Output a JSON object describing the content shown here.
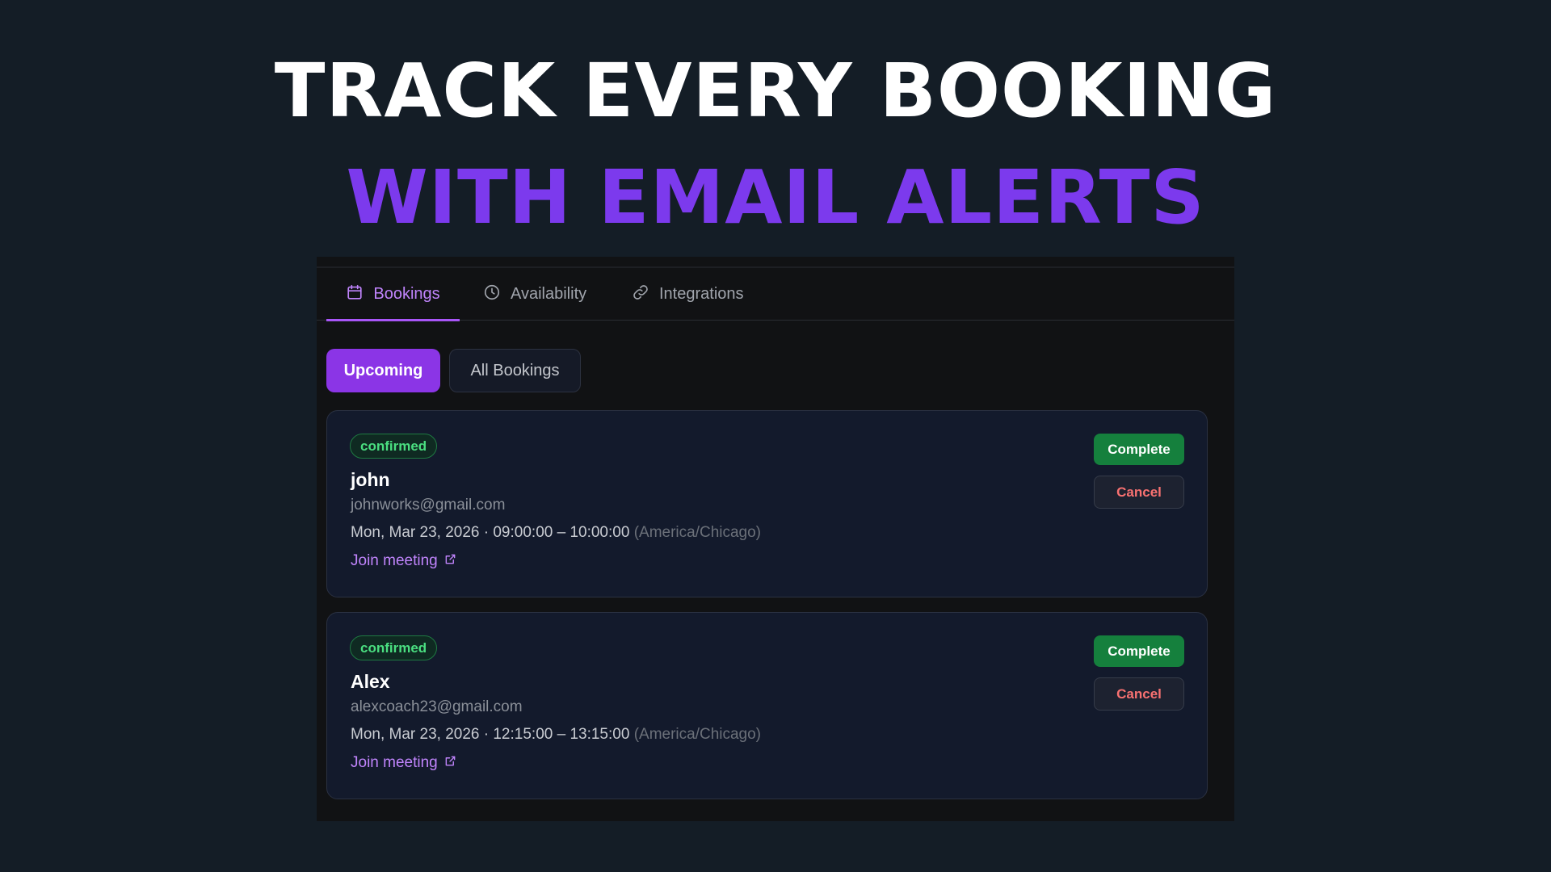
{
  "headline": {
    "line1": "TRACK EVERY BOOKING",
    "line2": "WITH EMAIL ALERTS"
  },
  "colors": {
    "background": "#141d26",
    "headline_accent": "#7c3aed",
    "active_tab": "#c084fc",
    "primary_button": "#8b35e6",
    "complete_button": "#15803d",
    "cancel_text": "#f87171",
    "badge_text": "#4ade80"
  },
  "tabs": [
    {
      "label": "Bookings",
      "icon": "calendar-icon",
      "active": true
    },
    {
      "label": "Availability",
      "icon": "clock-icon",
      "active": false
    },
    {
      "label": "Integrations",
      "icon": "link-icon",
      "active": false
    }
  ],
  "filters": {
    "upcoming_label": "Upcoming",
    "all_label": "All Bookings",
    "selected": "Upcoming"
  },
  "bookings": [
    {
      "status": "confirmed",
      "name": "john",
      "email": "johnworks@gmail.com",
      "datetime": "Mon, Mar 23, 2026 · 09:00:00 – 10:00:00",
      "timezone": "(America/Chicago)",
      "join_label": "Join meeting",
      "complete_label": "Complete",
      "cancel_label": "Cancel"
    },
    {
      "status": "confirmed",
      "name": "Alex",
      "email": "alexcoach23@gmail.com",
      "datetime": "Mon, Mar 23, 2026 · 12:15:00 – 13:15:00",
      "timezone": "(America/Chicago)",
      "join_label": "Join meeting",
      "complete_label": "Complete",
      "cancel_label": "Cancel"
    }
  ]
}
